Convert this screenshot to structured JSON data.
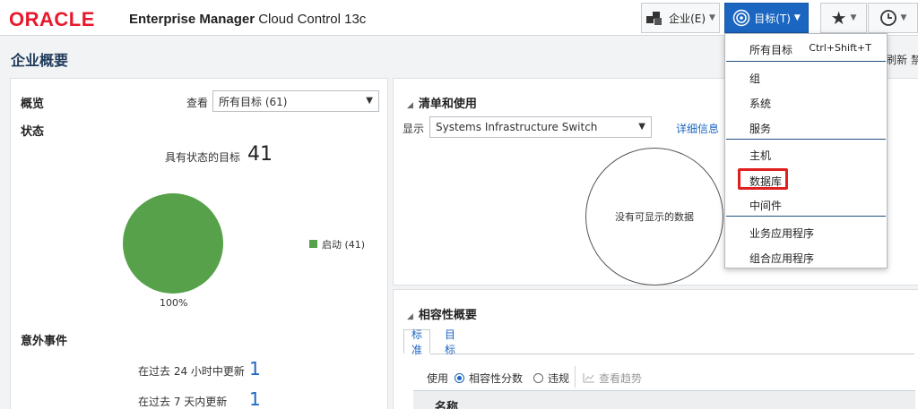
{
  "header": {
    "logo": "ORACLE",
    "product_bold": "Enterprise Manager",
    "product_rest": "Cloud Control 13c",
    "enterprise_menu": "企业(E)",
    "targets_menu": "目标(T)"
  },
  "page": {
    "title": "企业概要",
    "right_fragment_1": "刷新",
    "right_fragment_2": "禁"
  },
  "overview": {
    "title": "概览",
    "view_label": "查看",
    "view_value": "所有目标 (61)",
    "status_title": "状态",
    "targets_with_status_label": "具有状态的目标",
    "targets_with_status_value": "41",
    "pie_percent_label": "100%",
    "legend_label": "启动 (41)",
    "incidents_title": "意外事件",
    "incidents_24h_label": "在过去 24 小时中更新",
    "incidents_24h_value": "1",
    "incidents_7d_label": "在过去 7 天内更新",
    "incidents_7d_value": "1"
  },
  "inventory": {
    "title": "清单和使用",
    "show_label": "显示",
    "show_value": "Systems Infrastructure Switch",
    "details_link": "详细信息",
    "no_data": "没有可显示的数据"
  },
  "compliance": {
    "title": "相容性概要",
    "tabs": [
      "标准",
      "目标"
    ],
    "use_label": "使用",
    "radio_score": "相容性分数",
    "radio_violation": "违规",
    "trend_button": "查看趋势",
    "table_col_name": "名称"
  },
  "targets_menu": {
    "items": [
      {
        "label": "所有目标",
        "shortcut": "Ctrl+Shift+T"
      },
      {
        "label": "组"
      },
      {
        "label": "系统"
      },
      {
        "label": "服务"
      },
      {
        "label": "主机"
      },
      {
        "label": "数据库"
      },
      {
        "label": "中间件"
      },
      {
        "label": "业务应用程序"
      },
      {
        "label": "组合应用程序"
      }
    ]
  },
  "colors": {
    "accent": "#1a66c1",
    "oracle_red": "#e8192c",
    "status_up": "#56a14a",
    "highlight": "#e01f1f"
  },
  "icons": [
    "enterprise-icon",
    "target-icon",
    "favorites-star-icon",
    "history-clock-icon",
    "chevron-down-icon",
    "collapse-triangle-icon",
    "trend-chart-icon"
  ]
}
